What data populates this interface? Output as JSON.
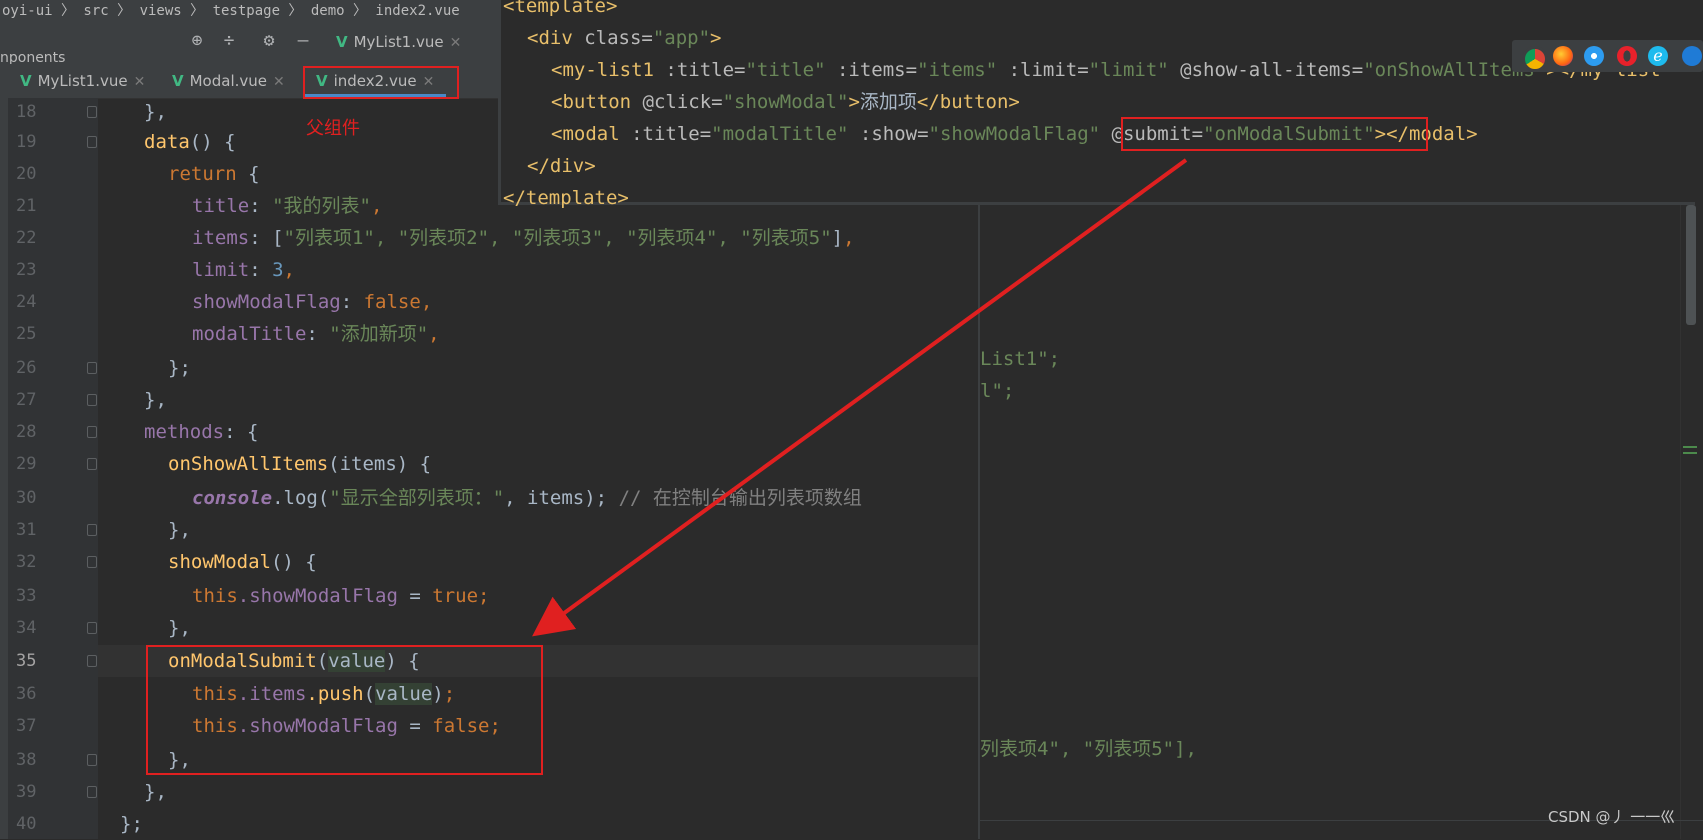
{
  "breadcrumb": {
    "text": "oyi-ui 〉 src 〉 views 〉 testpage 〉 demo 〉 index2.vue"
  },
  "project_panel": {
    "label": "nponents"
  },
  "toolbar": {
    "tab_mylist1_label": "MyList1.vue",
    "icons": [
      "target-icon",
      "collapse-icon",
      "gear-icon",
      "minimize-icon"
    ]
  },
  "editor_tabs": [
    {
      "label": "MyList1.vue"
    },
    {
      "label": "Modal.vue"
    },
    {
      "label": "index2.vue"
    }
  ],
  "annotation": {
    "parent_label": "父组件",
    "arrow_color": "#e02020"
  },
  "gutter": {
    "line_numbers": [
      "18",
      "19",
      "20",
      "21",
      "22",
      "23",
      "24",
      "25",
      "26",
      "27",
      "28",
      "29",
      "30",
      "31",
      "32",
      "33",
      "34",
      "35",
      "36",
      "37",
      "38",
      "39",
      "40"
    ]
  },
  "code": {
    "l18": "},",
    "l19_fn": "data",
    "l19_rest": "() {",
    "l20_kw": "return",
    "l20_rest": " {",
    "l21_prop": "title",
    "l21_str": "\"我的列表\"",
    "l22_prop": "items",
    "l22_strs": "\"列表项1\", \"列表项2\", \"列表项3\", \"列表项4\", \"列表项5\"",
    "l23_prop": "limit",
    "l23_num": "3",
    "l24_prop": "showModalFlag",
    "l24_kw": "false",
    "l25_prop": "modalTitle",
    "l25_str": "\"添加新项\"",
    "l26": "};",
    "l27": "},",
    "l28_prop": "methods",
    "l28_rest": ": {",
    "l29_fn": "onShowAllItems",
    "l29_rest": "(items) {",
    "l30_obj": "console",
    "l30_call": ".log(",
    "l30_str": "\"显示全部列表项：\"",
    "l30_args": ", items);",
    "l30_cmt": " // 在控制台输出列表项数组",
    "l31": "},",
    "l32_fn": "showModal",
    "l32_rest": "() {",
    "l33_this": "this",
    "l33_prop": ".showModalFlag",
    "l33_eq": " = ",
    "l33_kw": "true",
    "l34": "},",
    "l35_fn": "onModalSubmit",
    "l35_param": "value",
    "l35_rest": ") {",
    "l36_this": "this",
    "l36_prop": ".items",
    "l36_fn": ".push",
    "l36_param": "value",
    "l37_this": "this",
    "l37_prop": ".showModalFlag",
    "l37_kw": "false",
    "l38": "},",
    "l39": "},",
    "l40": "};"
  },
  "template_popup": {
    "line1": "<template>",
    "line2_tag": "<div",
    "line2_attr": " class=",
    "line2_val": "\"app\"",
    "line2_end": ">",
    "line3_tag": "<my-list1",
    "line3_a1": " :title=",
    "line3_v1": "\"title\"",
    "line3_a2": " :items=",
    "line3_v2": "\"items\"",
    "line3_a3": " :limit=",
    "line3_v3": "\"limit\"",
    "line3_a4": " @show-all-items=",
    "line3_v4": "\"onShowAllItems\"",
    "line3_end": "></my-list",
    "line4_tag": "<button",
    "line4_a1": " @click=",
    "line4_v1": "\"showModal\"",
    "line4_gt": ">",
    "line4_text": "添加项",
    "line4_close": "</button>",
    "line5_tag": "<modal",
    "line5_a1": " :title=",
    "line5_v1": "\"modalTitle\"",
    "line5_a2": " :show=",
    "line5_v2": "\"showModalFlag\"",
    "line5_a3": " @submit=",
    "line5_v3": "\"onModalSubmit\"",
    "line5_gt": ">",
    "line5_close": "</modal>",
    "line6": "</div>",
    "line7": "</template>"
  },
  "right_fragments": {
    "frag1": "List1\";",
    "frag2": "l\";",
    "frag3": "列表项4\", \"列表项5\"],"
  },
  "browser_icons": [
    "chrome-icon",
    "firefox-icon",
    "safari-icon",
    "opera-icon",
    "ie-icon",
    "edge-icon"
  ],
  "watermark": "CSDN @丿 一一巛"
}
